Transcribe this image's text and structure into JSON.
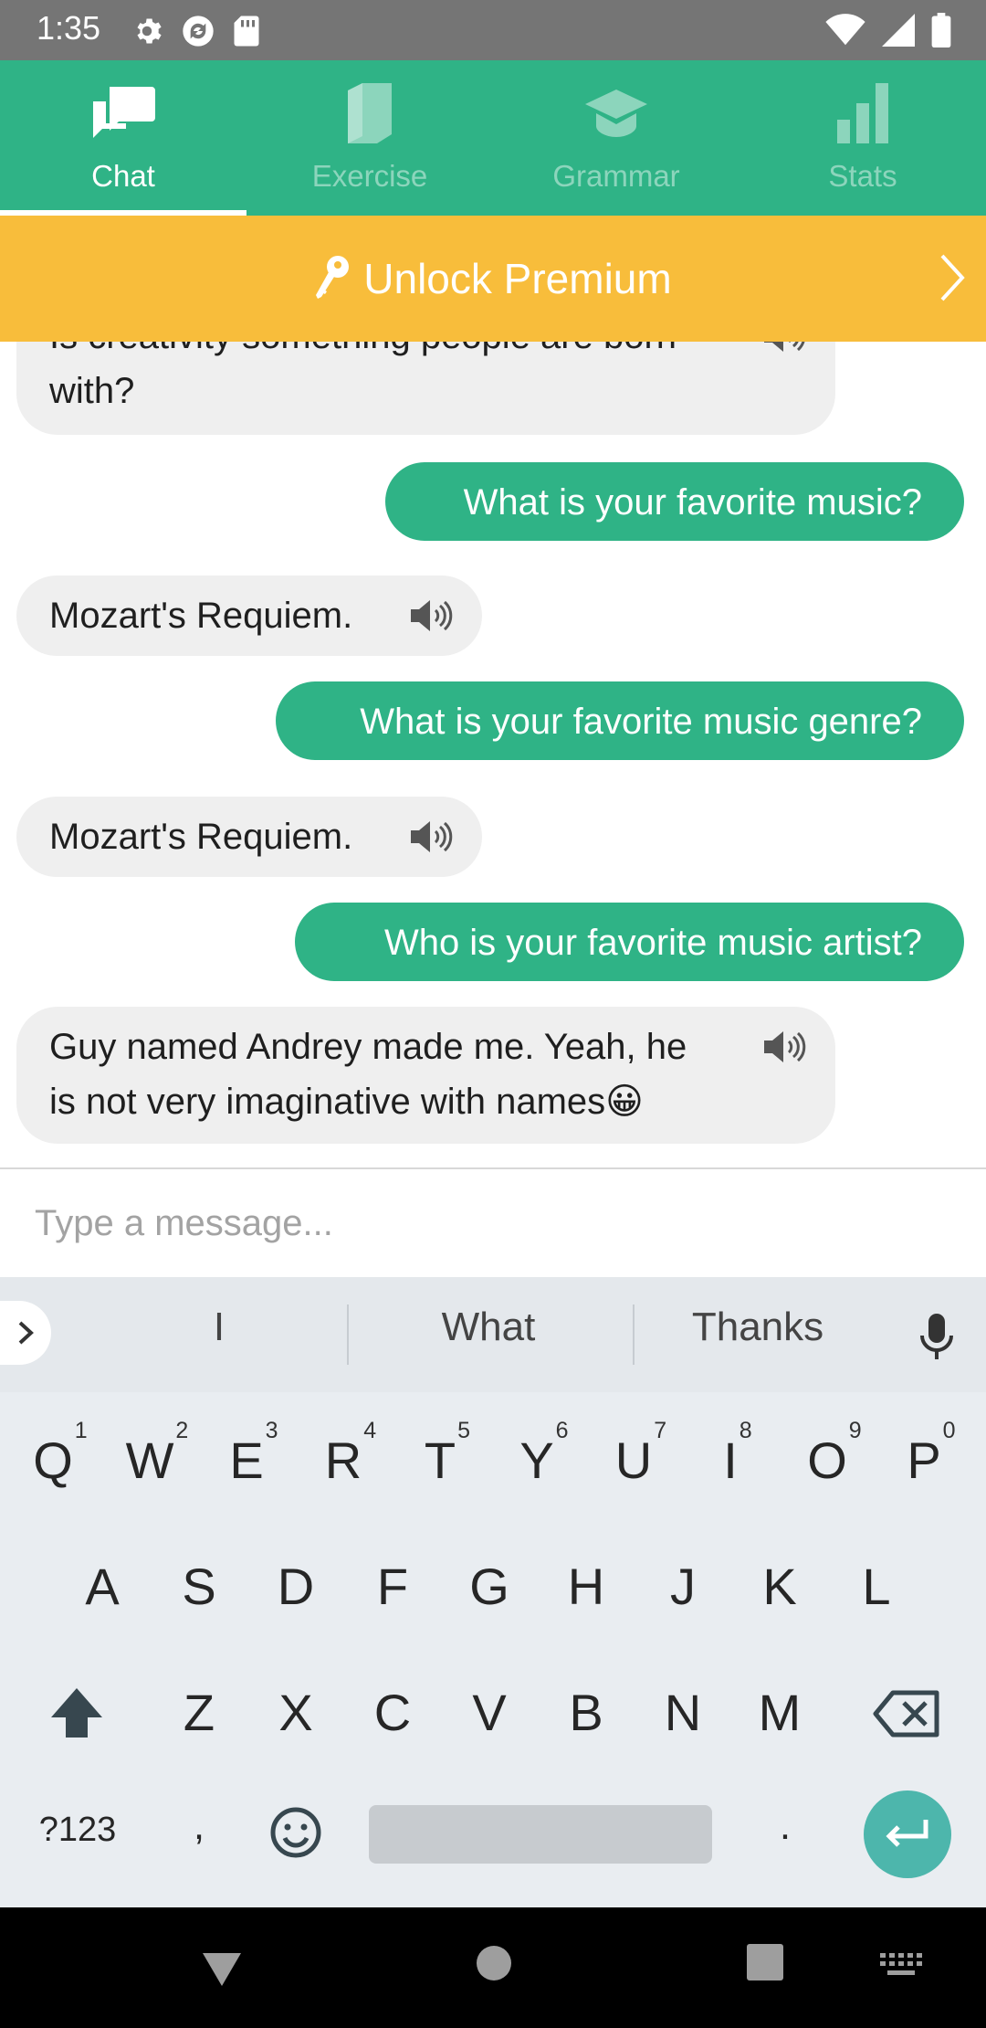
{
  "status_bar": {
    "time": "1:35",
    "left_icons": [
      "gear-icon",
      "sync-icon",
      "sd-card-icon"
    ],
    "right_icons": [
      "wifi-icon",
      "signal-icon",
      "battery-icon"
    ]
  },
  "tabs": [
    {
      "label": "Chat",
      "icon": "chat-bubbles-icon",
      "active": true
    },
    {
      "label": "Exercise",
      "icon": "book-icon",
      "active": false
    },
    {
      "label": "Grammar",
      "icon": "graduation-cap-icon",
      "active": false
    },
    {
      "label": "Stats",
      "icon": "bar-chart-icon",
      "active": false
    }
  ],
  "premium_banner": {
    "label": "Unlock Premium",
    "icon": "key-icon",
    "chevron": "chevron-right-icon"
  },
  "messages": [
    {
      "from": "bot",
      "line1": "Is creativity something people are born",
      "line2": "with?"
    },
    {
      "from": "user",
      "text": "What is your favorite music?"
    },
    {
      "from": "bot",
      "text": "Mozart's Requiem."
    },
    {
      "from": "user",
      "text": "What is your favorite music genre?"
    },
    {
      "from": "bot",
      "text": "Mozart's Requiem."
    },
    {
      "from": "user",
      "text": "Who is your favorite music artist?"
    },
    {
      "from": "bot",
      "line1": "Guy named Andrey made me. Yeah, he",
      "line2": "is not very imaginative with names😀"
    }
  ],
  "input": {
    "placeholder": "Type a message..."
  },
  "keyboard": {
    "suggestions": [
      "I",
      "What",
      "Thanks"
    ],
    "row1": [
      "Q",
      "W",
      "E",
      "R",
      "T",
      "Y",
      "U",
      "I",
      "O",
      "P"
    ],
    "row1_hints": [
      "1",
      "2",
      "3",
      "4",
      "5",
      "6",
      "7",
      "8",
      "9",
      "0"
    ],
    "row2": [
      "A",
      "S",
      "D",
      "F",
      "G",
      "H",
      "J",
      "K",
      "L"
    ],
    "row3": [
      "Z",
      "X",
      "C",
      "V",
      "B",
      "N",
      "M"
    ],
    "symbols_key": "?123",
    "comma_key": ",",
    "period_key": "."
  },
  "colors": {
    "brand_green": "#2fb386",
    "premium_yellow": "#f8bd3b",
    "enter_teal": "#4db6ac"
  }
}
